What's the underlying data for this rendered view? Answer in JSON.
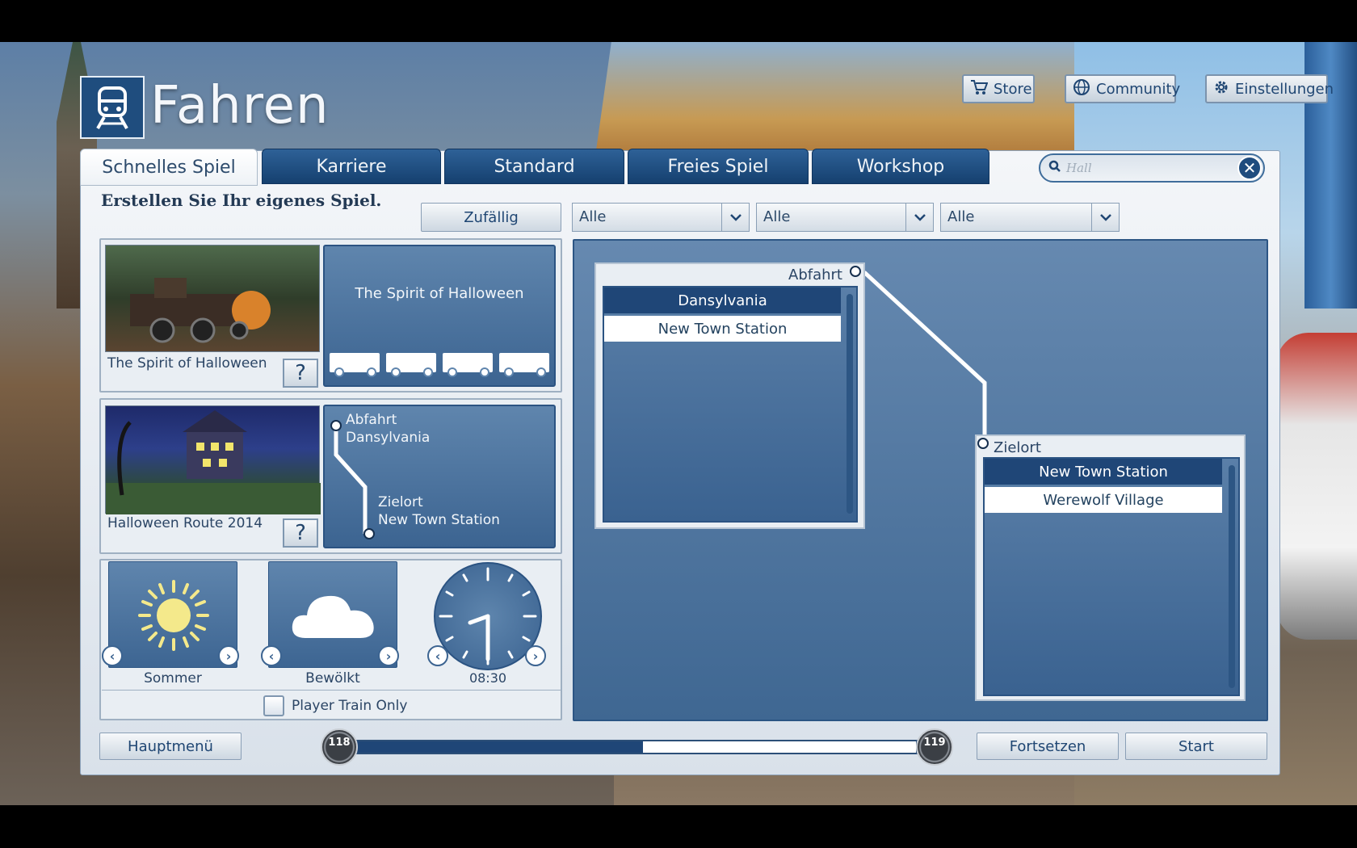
{
  "header": {
    "title": "Fahren"
  },
  "top_buttons": {
    "store": "Store",
    "community": "Community",
    "settings": "Einstellungen"
  },
  "tabs": [
    {
      "label": "Schnelles Spiel",
      "active": true
    },
    {
      "label": "Karriere"
    },
    {
      "label": "Standard"
    },
    {
      "label": "Freies Spiel"
    },
    {
      "label": "Workshop"
    }
  ],
  "search": {
    "placeholder": "Hall"
  },
  "subtitle": "Erstellen Sie Ihr eigenes Spiel.",
  "filters": {
    "random_label": "Zufällig",
    "filter1": "Alle",
    "filter2": "Alle",
    "filter3": "Alle"
  },
  "train_card": {
    "name": "The Spirit of Halloween",
    "help": "?",
    "preview_title": "The Spirit of Halloween"
  },
  "route_card": {
    "name": "Halloween Route 2014",
    "help": "?",
    "departure_label": "Abfahrt",
    "departure_station": "Dansylvania",
    "destination_label": "Zielort",
    "destination_station": "New Town Station"
  },
  "conditions": {
    "season": "Sommer",
    "weather": "Bewölkt",
    "time": "08:30",
    "player_train_only": "Player Train Only"
  },
  "departure_list": {
    "label": "Abfahrt",
    "items": [
      "Dansylvania",
      "New Town Station"
    ],
    "selected": 0
  },
  "destination_list": {
    "label": "Zielort",
    "items": [
      "New Town Station",
      "Werewolf Village"
    ],
    "selected": 0
  },
  "footer": {
    "main_menu": "Hauptmenü",
    "continue": "Fortsetzen",
    "start": "Start",
    "level_current": "118",
    "level_next": "119",
    "progress": 0.52
  },
  "colors": {
    "accent": "#1f4677",
    "panel_blue": "#4a719b"
  }
}
